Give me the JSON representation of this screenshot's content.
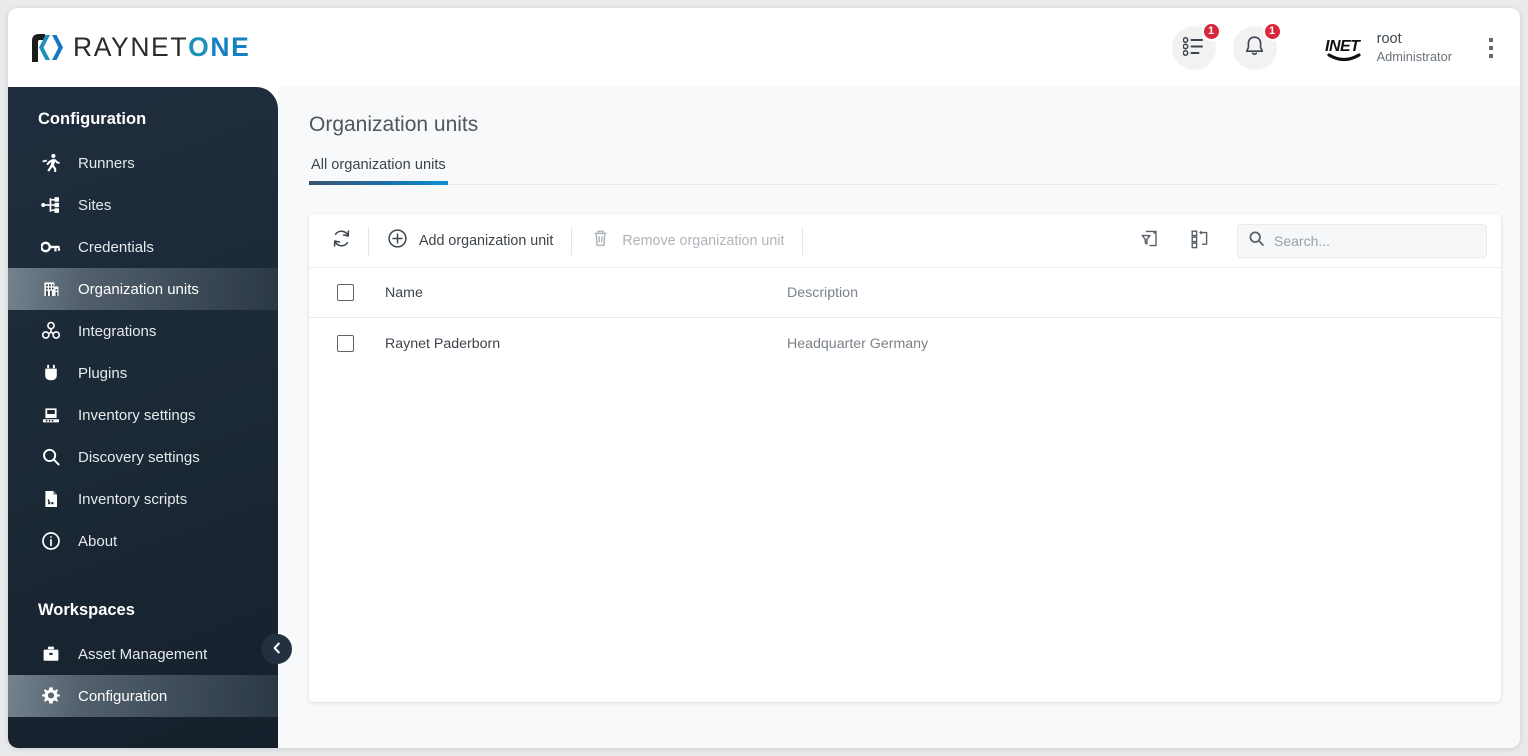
{
  "header": {
    "logo": {
      "mark_icon": "raynet-bracket-chevrons-icon",
      "text_part1": "RAYNET",
      "text_part2": "O",
      "text_part3": "NE"
    },
    "tasks_button": {
      "icon": "task-list-icon",
      "badge": "1"
    },
    "notifications_button": {
      "icon": "bell-icon",
      "badge": "1"
    },
    "avatar": {
      "icon": "inet-avatar-logo",
      "text": "INET"
    },
    "user_name": "root",
    "user_role": "Administrator",
    "more_menu_icon": "vertical-dots-icon"
  },
  "sidebar": {
    "configuration_heading": "Configuration",
    "configuration_items": [
      {
        "label": "Runners",
        "icon": "runner-icon",
        "active": false
      },
      {
        "label": "Sites",
        "icon": "sitemap-icon",
        "active": false
      },
      {
        "label": "Credentials",
        "icon": "key-icon",
        "active": false
      },
      {
        "label": "Organization units",
        "icon": "building-icon",
        "active": true
      },
      {
        "label": "Integrations",
        "icon": "integrations-icon",
        "active": false
      },
      {
        "label": "Plugins",
        "icon": "plugin-icon",
        "active": false
      },
      {
        "label": "Inventory settings",
        "icon": "laptop-icon",
        "active": false
      },
      {
        "label": "Discovery settings",
        "icon": "magnifier-icon",
        "active": false
      },
      {
        "label": "Inventory scripts",
        "icon": "script-file-icon",
        "active": false
      },
      {
        "label": "About",
        "icon": "info-circle-icon",
        "active": false
      }
    ],
    "workspaces_heading": "Workspaces",
    "workspaces_items": [
      {
        "label": "Asset Management",
        "icon": "briefcase-icon",
        "active": false
      },
      {
        "label": "Configuration",
        "icon": "gear-icon",
        "active": true
      }
    ],
    "collapse_button_icon": "chevron-left-icon"
  },
  "main": {
    "page_title": "Organization units",
    "tabs": [
      {
        "label": "All organization units",
        "active": true
      }
    ],
    "toolbar": {
      "refresh_icon": "refresh-icon",
      "add_label": "Add organization unit",
      "add_icon": "plus-circle-icon",
      "remove_label": "Remove organization unit",
      "remove_icon": "trash-icon",
      "remove_disabled": true,
      "filter_icon": "filter-page-icon",
      "columns_icon": "column-chooser-icon",
      "search_icon": "search-icon",
      "search_placeholder": "Search...",
      "search_value": ""
    },
    "table": {
      "columns": [
        "Name",
        "Description"
      ],
      "rows": [
        {
          "name": "Raynet Paderborn",
          "description": "Headquarter Germany",
          "checked": false
        }
      ]
    }
  },
  "colors": {
    "sidebar_bg": "#1b2835",
    "accent_blue": "#0d8ed2",
    "accent_teal": "#1d91b8",
    "badge_red": "#d8263c",
    "active_item": "#5a6773",
    "panel_bg": "#ffffff",
    "main_bg": "#f8f9fa"
  }
}
